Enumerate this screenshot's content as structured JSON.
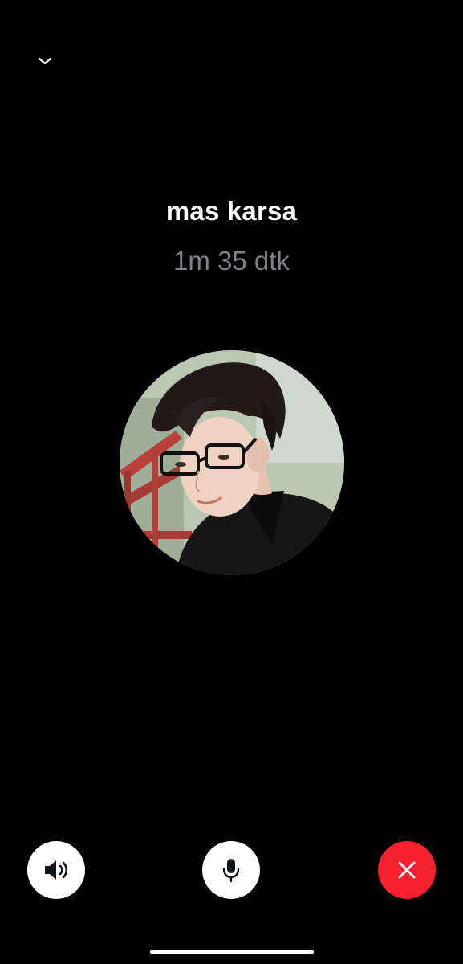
{
  "call": {
    "caller_name": "mas karsa",
    "duration": "1m 35 dtk"
  },
  "icons": {
    "collapse": "chevron-down-icon",
    "speaker": "speaker-icon",
    "microphone": "microphone-icon",
    "end_call": "close-icon"
  },
  "colors": {
    "background": "#000000",
    "name_text": "#ffffff",
    "duration_text": "#7c8289",
    "control_bg": "#ffffff",
    "end_call_bg": "#f4212e"
  }
}
